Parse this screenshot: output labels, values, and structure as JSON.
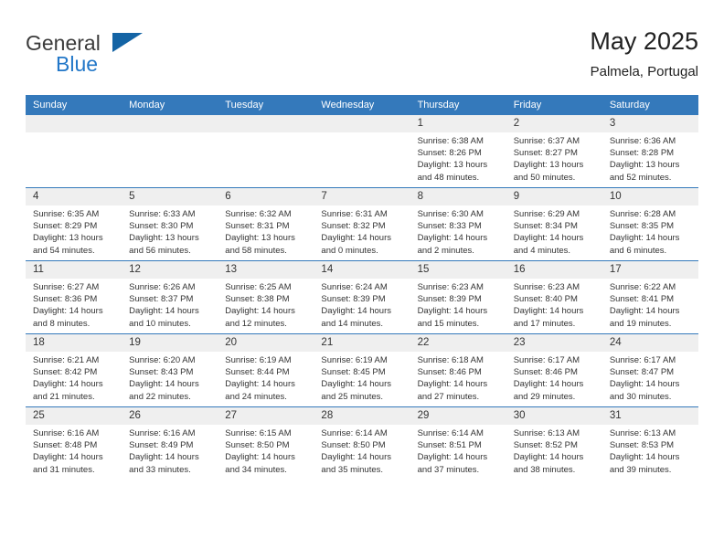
{
  "brand": {
    "name_top": "General",
    "name_bottom": "Blue",
    "triangle_icon": "triangle-icon",
    "color_dark": "#3b3b3b",
    "color_blue": "#2277c8"
  },
  "header": {
    "title": "May 2025",
    "subtitle": "Palmela, Portugal"
  },
  "theme": {
    "header_bg": "#3479bb",
    "daynum_bg": "#efefef",
    "text": "#333333"
  },
  "weekday_headers": [
    "Sunday",
    "Monday",
    "Tuesday",
    "Wednesday",
    "Thursday",
    "Friday",
    "Saturday"
  ],
  "labels": {
    "sunrise_prefix": "Sunrise:",
    "sunset_prefix": "Sunset:",
    "daylight_prefix": "Daylight:"
  },
  "weeks": [
    [
      {
        "day": "",
        "sunrise": "",
        "sunset": "",
        "daylight_line1": "",
        "daylight_line2": ""
      },
      {
        "day": "",
        "sunrise": "",
        "sunset": "",
        "daylight_line1": "",
        "daylight_line2": ""
      },
      {
        "day": "",
        "sunrise": "",
        "sunset": "",
        "daylight_line1": "",
        "daylight_line2": ""
      },
      {
        "day": "",
        "sunrise": "",
        "sunset": "",
        "daylight_line1": "",
        "daylight_line2": ""
      },
      {
        "day": "1",
        "sunrise": "Sunrise: 6:38 AM",
        "sunset": "Sunset: 8:26 PM",
        "daylight_line1": "Daylight: 13 hours",
        "daylight_line2": "and 48 minutes."
      },
      {
        "day": "2",
        "sunrise": "Sunrise: 6:37 AM",
        "sunset": "Sunset: 8:27 PM",
        "daylight_line1": "Daylight: 13 hours",
        "daylight_line2": "and 50 minutes."
      },
      {
        "day": "3",
        "sunrise": "Sunrise: 6:36 AM",
        "sunset": "Sunset: 8:28 PM",
        "daylight_line1": "Daylight: 13 hours",
        "daylight_line2": "and 52 minutes."
      }
    ],
    [
      {
        "day": "4",
        "sunrise": "Sunrise: 6:35 AM",
        "sunset": "Sunset: 8:29 PM",
        "daylight_line1": "Daylight: 13 hours",
        "daylight_line2": "and 54 minutes."
      },
      {
        "day": "5",
        "sunrise": "Sunrise: 6:33 AM",
        "sunset": "Sunset: 8:30 PM",
        "daylight_line1": "Daylight: 13 hours",
        "daylight_line2": "and 56 minutes."
      },
      {
        "day": "6",
        "sunrise": "Sunrise: 6:32 AM",
        "sunset": "Sunset: 8:31 PM",
        "daylight_line1": "Daylight: 13 hours",
        "daylight_line2": "and 58 minutes."
      },
      {
        "day": "7",
        "sunrise": "Sunrise: 6:31 AM",
        "sunset": "Sunset: 8:32 PM",
        "daylight_line1": "Daylight: 14 hours",
        "daylight_line2": "and 0 minutes."
      },
      {
        "day": "8",
        "sunrise": "Sunrise: 6:30 AM",
        "sunset": "Sunset: 8:33 PM",
        "daylight_line1": "Daylight: 14 hours",
        "daylight_line2": "and 2 minutes."
      },
      {
        "day": "9",
        "sunrise": "Sunrise: 6:29 AM",
        "sunset": "Sunset: 8:34 PM",
        "daylight_line1": "Daylight: 14 hours",
        "daylight_line2": "and 4 minutes."
      },
      {
        "day": "10",
        "sunrise": "Sunrise: 6:28 AM",
        "sunset": "Sunset: 8:35 PM",
        "daylight_line1": "Daylight: 14 hours",
        "daylight_line2": "and 6 minutes."
      }
    ],
    [
      {
        "day": "11",
        "sunrise": "Sunrise: 6:27 AM",
        "sunset": "Sunset: 8:36 PM",
        "daylight_line1": "Daylight: 14 hours",
        "daylight_line2": "and 8 minutes."
      },
      {
        "day": "12",
        "sunrise": "Sunrise: 6:26 AM",
        "sunset": "Sunset: 8:37 PM",
        "daylight_line1": "Daylight: 14 hours",
        "daylight_line2": "and 10 minutes."
      },
      {
        "day": "13",
        "sunrise": "Sunrise: 6:25 AM",
        "sunset": "Sunset: 8:38 PM",
        "daylight_line1": "Daylight: 14 hours",
        "daylight_line2": "and 12 minutes."
      },
      {
        "day": "14",
        "sunrise": "Sunrise: 6:24 AM",
        "sunset": "Sunset: 8:39 PM",
        "daylight_line1": "Daylight: 14 hours",
        "daylight_line2": "and 14 minutes."
      },
      {
        "day": "15",
        "sunrise": "Sunrise: 6:23 AM",
        "sunset": "Sunset: 8:39 PM",
        "daylight_line1": "Daylight: 14 hours",
        "daylight_line2": "and 15 minutes."
      },
      {
        "day": "16",
        "sunrise": "Sunrise: 6:23 AM",
        "sunset": "Sunset: 8:40 PM",
        "daylight_line1": "Daylight: 14 hours",
        "daylight_line2": "and 17 minutes."
      },
      {
        "day": "17",
        "sunrise": "Sunrise: 6:22 AM",
        "sunset": "Sunset: 8:41 PM",
        "daylight_line1": "Daylight: 14 hours",
        "daylight_line2": "and 19 minutes."
      }
    ],
    [
      {
        "day": "18",
        "sunrise": "Sunrise: 6:21 AM",
        "sunset": "Sunset: 8:42 PM",
        "daylight_line1": "Daylight: 14 hours",
        "daylight_line2": "and 21 minutes."
      },
      {
        "day": "19",
        "sunrise": "Sunrise: 6:20 AM",
        "sunset": "Sunset: 8:43 PM",
        "daylight_line1": "Daylight: 14 hours",
        "daylight_line2": "and 22 minutes."
      },
      {
        "day": "20",
        "sunrise": "Sunrise: 6:19 AM",
        "sunset": "Sunset: 8:44 PM",
        "daylight_line1": "Daylight: 14 hours",
        "daylight_line2": "and 24 minutes."
      },
      {
        "day": "21",
        "sunrise": "Sunrise: 6:19 AM",
        "sunset": "Sunset: 8:45 PM",
        "daylight_line1": "Daylight: 14 hours",
        "daylight_line2": "and 25 minutes."
      },
      {
        "day": "22",
        "sunrise": "Sunrise: 6:18 AM",
        "sunset": "Sunset: 8:46 PM",
        "daylight_line1": "Daylight: 14 hours",
        "daylight_line2": "and 27 minutes."
      },
      {
        "day": "23",
        "sunrise": "Sunrise: 6:17 AM",
        "sunset": "Sunset: 8:46 PM",
        "daylight_line1": "Daylight: 14 hours",
        "daylight_line2": "and 29 minutes."
      },
      {
        "day": "24",
        "sunrise": "Sunrise: 6:17 AM",
        "sunset": "Sunset: 8:47 PM",
        "daylight_line1": "Daylight: 14 hours",
        "daylight_line2": "and 30 minutes."
      }
    ],
    [
      {
        "day": "25",
        "sunrise": "Sunrise: 6:16 AM",
        "sunset": "Sunset: 8:48 PM",
        "daylight_line1": "Daylight: 14 hours",
        "daylight_line2": "and 31 minutes."
      },
      {
        "day": "26",
        "sunrise": "Sunrise: 6:16 AM",
        "sunset": "Sunset: 8:49 PM",
        "daylight_line1": "Daylight: 14 hours",
        "daylight_line2": "and 33 minutes."
      },
      {
        "day": "27",
        "sunrise": "Sunrise: 6:15 AM",
        "sunset": "Sunset: 8:50 PM",
        "daylight_line1": "Daylight: 14 hours",
        "daylight_line2": "and 34 minutes."
      },
      {
        "day": "28",
        "sunrise": "Sunrise: 6:14 AM",
        "sunset": "Sunset: 8:50 PM",
        "daylight_line1": "Daylight: 14 hours",
        "daylight_line2": "and 35 minutes."
      },
      {
        "day": "29",
        "sunrise": "Sunrise: 6:14 AM",
        "sunset": "Sunset: 8:51 PM",
        "daylight_line1": "Daylight: 14 hours",
        "daylight_line2": "and 37 minutes."
      },
      {
        "day": "30",
        "sunrise": "Sunrise: 6:13 AM",
        "sunset": "Sunset: 8:52 PM",
        "daylight_line1": "Daylight: 14 hours",
        "daylight_line2": "and 38 minutes."
      },
      {
        "day": "31",
        "sunrise": "Sunrise: 6:13 AM",
        "sunset": "Sunset: 8:53 PM",
        "daylight_line1": "Daylight: 14 hours",
        "daylight_line2": "and 39 minutes."
      }
    ]
  ]
}
